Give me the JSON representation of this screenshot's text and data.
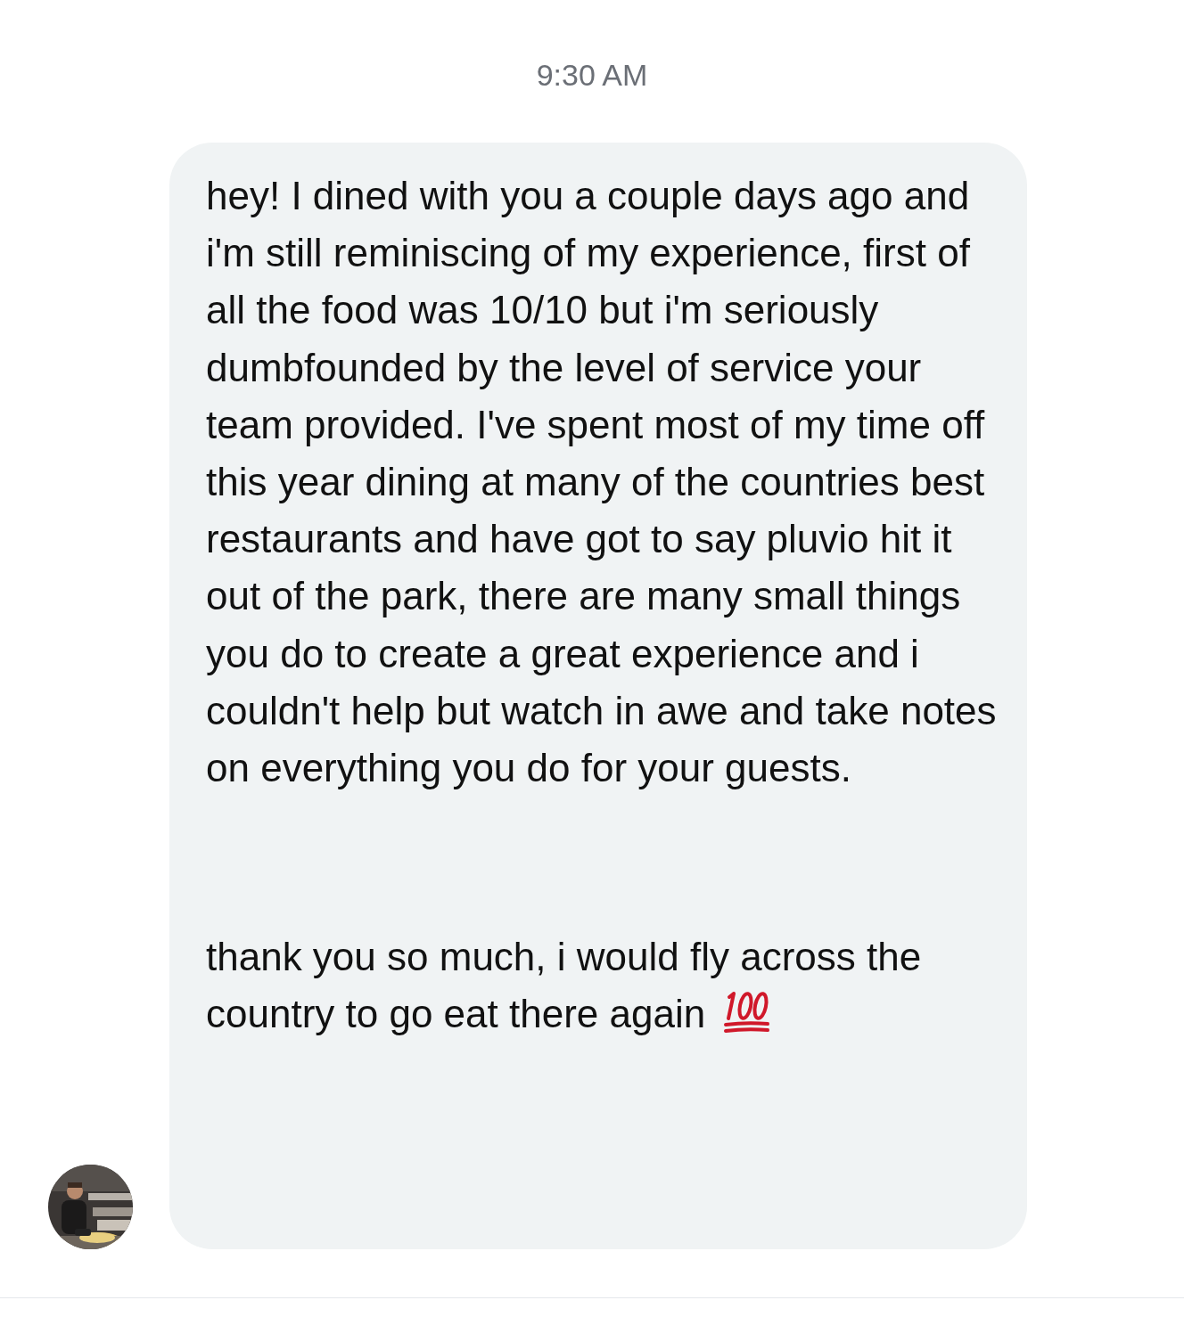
{
  "timestamp": "9:30 AM",
  "message": {
    "paragraphs": [
      "hey! I dined with you a couple days ago and i'm still reminiscing of my experience, first of all the food was 10/10 but i'm seriously dumbfounded by the level of service your team provided. I've spent most of my time off this year dining at many of the countries best restaurants and have got to say pluvio hit it out of the park, there are many small things you do to create a great experience and i couldn't help but watch in awe and take notes on everything you do for your guests.",
      "thank you so much, i would fly across the country to go eat there again"
    ]
  }
}
